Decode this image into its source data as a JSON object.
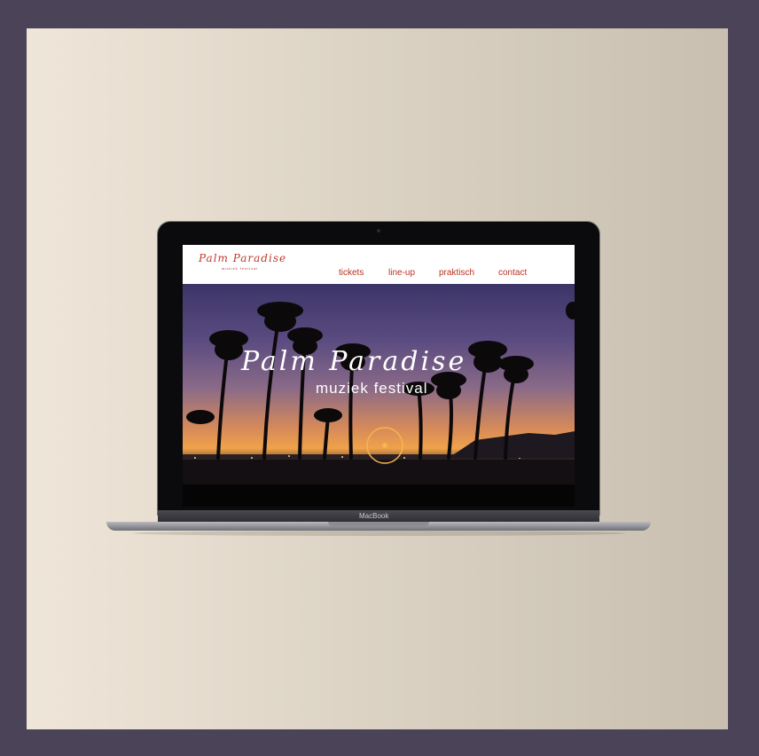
{
  "site": {
    "logo_title": "Palm Paradise",
    "logo_tagline": "muziek festival",
    "nav": [
      {
        "label": "tickets"
      },
      {
        "label": "line-up"
      },
      {
        "label": "praktisch"
      },
      {
        "label": "contact"
      }
    ]
  },
  "hero": {
    "title": "Palm Paradise",
    "subtitle": "muziek festival"
  },
  "device": {
    "brand_label": "MacBook"
  },
  "colors": {
    "frame": "#4b4459",
    "accent": "#b83222",
    "header_bg": "#ffffff"
  }
}
